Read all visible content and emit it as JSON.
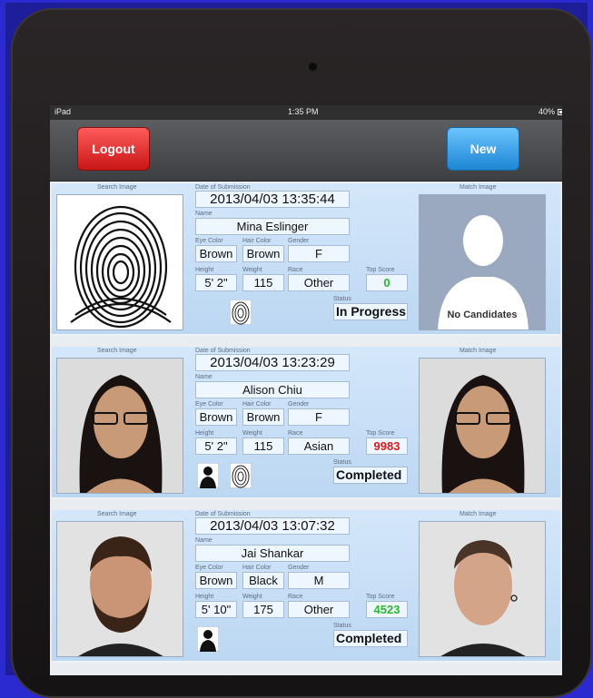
{
  "device": {
    "carrier": "iPad",
    "time": "1:35 PM",
    "battery": "40%"
  },
  "toolbar": {
    "logout_label": "Logout",
    "new_label": "New"
  },
  "labels": {
    "search_image": "Search Image",
    "match_image": "Match Image",
    "date": "Date of Submission",
    "name": "Name",
    "eye": "Eye Color",
    "hair": "Hair Color",
    "gender": "Gender",
    "height": "Height",
    "weight": "Weight",
    "race": "Race",
    "top_score": "Top Score",
    "status": "Status"
  },
  "colors": {
    "score_red": "#d81a1a",
    "score_green": "#2eb82e",
    "logout": "#e02a2a",
    "new": "#3aa4ee"
  },
  "records": [
    {
      "date": "2013/04/03 13:35:44",
      "name": "Mina Eslinger",
      "eye": "Brown",
      "hair": "Brown",
      "gender": "F",
      "height": "5' 2\"",
      "weight": "115",
      "race": "Other",
      "score": "0",
      "status": "In Progress",
      "no_candidates": "No Candidates"
    },
    {
      "date": "2013/04/03 13:23:29",
      "name": "Alison Chiu",
      "eye": "Brown",
      "hair": "Brown",
      "gender": "F",
      "height": "5' 2\"",
      "weight": "115",
      "race": "Asian",
      "score": "9983",
      "status": "Completed"
    },
    {
      "date": "2013/04/03 13:07:32",
      "name": "Jai Shankar",
      "eye": "Brown",
      "hair": "Black",
      "gender": "M",
      "height": "5' 10\"",
      "weight": "175",
      "race": "Other",
      "score": "4523",
      "status": "Completed"
    }
  ]
}
